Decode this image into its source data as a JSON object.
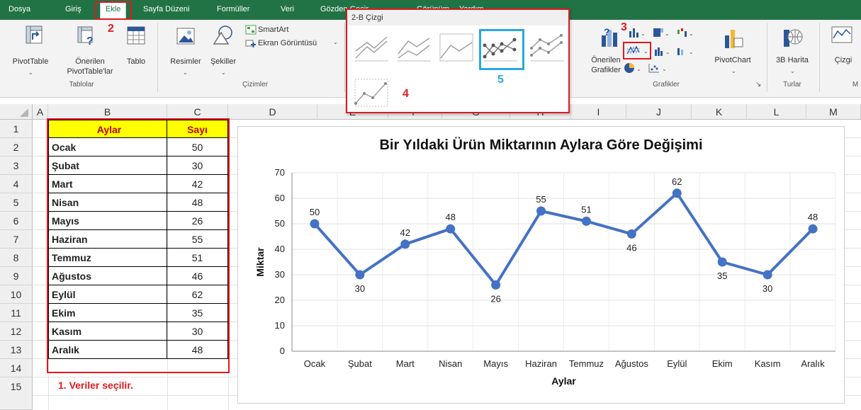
{
  "menu": {
    "tabs": [
      "Dosya",
      "Giriş",
      "Ekle",
      "Sayfa Düzeni",
      "Formüller",
      "Veri",
      "Gözden Geçir",
      "Görünüm",
      "Yardım"
    ],
    "active_tab": "Ekle"
  },
  "ribbon": {
    "tables_group": {
      "label": "Tablolar",
      "pivottable": "PivotTable",
      "recommended_line1": "Önerilen",
      "recommended_line2": "PivotTable'lar",
      "table": "Tablo"
    },
    "illustrations_group": {
      "label": "Çizimler",
      "pictures": "Resimler",
      "shapes": "Şekiller",
      "smartart": "SmartArt",
      "screenshot": "Ekran Görüntüsü"
    },
    "charts_group": {
      "label": "Grafikler",
      "recommended_line1": "Önerilen",
      "recommended_line2": "Grafikler",
      "pivotchart": "PivotChart"
    },
    "tours_group": {
      "label": "Turlar",
      "map3d": "3B Harita"
    },
    "sparklines_group": {
      "line": "Çizgi",
      "partial": "M"
    }
  },
  "dropdown": {
    "title": "2-B Çizgi"
  },
  "annotations": {
    "step1": "1. Veriler seçilir.",
    "step2": "2",
    "step3": "3",
    "step4": "4",
    "step5": "5"
  },
  "sheet": {
    "columns": [
      "A",
      "B",
      "C",
      "D",
      "E",
      "F",
      "G",
      "H",
      "I",
      "J",
      "K",
      "L",
      "M"
    ],
    "rows": [
      "1",
      "2",
      "3",
      "4",
      "5",
      "6",
      "7",
      "8",
      "9",
      "10",
      "11",
      "12",
      "13",
      "14",
      "15"
    ],
    "header": {
      "month": "Aylar",
      "count": "Sayı"
    },
    "data": [
      {
        "month": "Ocak",
        "count": "50"
      },
      {
        "month": "Şubat",
        "count": "30"
      },
      {
        "month": "Mart",
        "count": "42"
      },
      {
        "month": "Nisan",
        "count": "48"
      },
      {
        "month": "Mayıs",
        "count": "26"
      },
      {
        "month": "Haziran",
        "count": "55"
      },
      {
        "month": "Temmuz",
        "count": "51"
      },
      {
        "month": "Ağustos",
        "count": "46"
      },
      {
        "month": "Eylül",
        "count": "62"
      },
      {
        "month": "Ekim",
        "count": "35"
      },
      {
        "month": "Kasım",
        "count": "30"
      },
      {
        "month": "Aralık",
        "count": "48"
      }
    ]
  },
  "chart_data": {
    "type": "line",
    "title": "Bir Yıldaki Ürün Miktarının Aylara Göre Değişimi",
    "xlabel": "Aylar",
    "ylabel": "Miktar",
    "ylim": [
      0,
      70
    ],
    "yticks": [
      0,
      10,
      20,
      30,
      40,
      50,
      60,
      70
    ],
    "grid": true,
    "categories": [
      "Ocak",
      "Şubat",
      "Mart",
      "Nisan",
      "Mayıs",
      "Haziran",
      "Temmuz",
      "Ağustos",
      "Eylül",
      "Ekim",
      "Kasım",
      "Aralık"
    ],
    "values": [
      50,
      30,
      42,
      48,
      26,
      55,
      51,
      46,
      62,
      35,
      30,
      48
    ],
    "label_position": [
      "above",
      "below",
      "above",
      "above",
      "below",
      "above",
      "above",
      "below",
      "above",
      "below",
      "below",
      "above"
    ],
    "color": "#4472c4"
  },
  "colors": {
    "excel_green": "#217346",
    "highlight_red": "#e0191f",
    "highlight_blue": "#28a8e0",
    "header_fill": "#ffff00",
    "header_text": "#c00000"
  }
}
